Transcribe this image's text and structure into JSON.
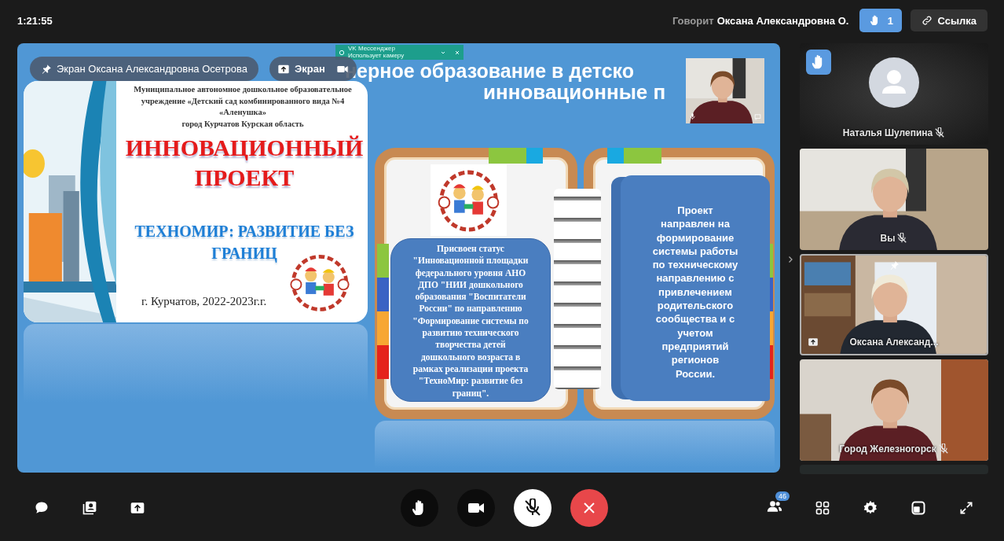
{
  "top_bar": {
    "time": "1:21:55",
    "speaker_label": "Говорит",
    "speaker_name": "Оксана Александровна О.",
    "raised_hands": "1",
    "link_button": "Ссылка"
  },
  "stage": {
    "pinned_label": "Экран Оксана Александровна Осетрова",
    "screen_button": "Экран",
    "notification": {
      "title": "VK Мессенджер",
      "text": "Использует камеру"
    },
    "slide": {
      "title_lines": [
        "нерное образование в детско",
        "инновационные п"
      ],
      "cover": {
        "header": "Муниципальное автономное дошкольное образовательное\nучреждение «Детский сад комбинированного вида №4\n«Аленушка»\nгород Курчатов Курская область",
        "title": "ИННОВАЦИОННЫЙ\nПРОЕКТ",
        "subtitle": "ТЕХНОМИР: РАЗВИТИЕ БЕЗ\nГРАНИЦ",
        "footer": "г. Курчатов, 2022-2023г.г."
      },
      "status_text": "Присвоен статус\n\"Инновационной площадки\nфедерального уровня АНО\nДПО \"НИИ дошкольного\nобразования \"Воспитатели\nРоссии\" по направлению\n\"Формирование системы по\nразвитию технического\nтворчества детей\nдошкольного возраста в\nрамках реализации проекта\n\"ТехноМир: развитие без\nграниц\".",
      "goal_text": "Проект\nнаправлен на\nформирование\nсистемы работы\nпо техническому\nнаправлению с\nпривлечением\nродительского\nсообщества и с\nучетом\nпредприятий\nрегионов\nРоссии."
    }
  },
  "tiles": [
    {
      "kind": "avatar",
      "name": "Наталья Шулепина",
      "muted": true,
      "hand_raised": true,
      "speaking": false,
      "sharing": false
    },
    {
      "kind": "video",
      "name": "Вы",
      "muted": true,
      "hand_raised": false,
      "speaking": false,
      "sharing": false
    },
    {
      "kind": "video",
      "name": "Оксана Александ...",
      "muted": false,
      "hand_raised": false,
      "speaking": true,
      "sharing": true
    },
    {
      "kind": "video",
      "name": "Город Железногорск",
      "muted": true,
      "hand_raised": false,
      "speaking": false,
      "sharing": false
    },
    {
      "kind": "blank"
    }
  ],
  "toolbar": {
    "mic_muted": true,
    "participants": "46"
  }
}
